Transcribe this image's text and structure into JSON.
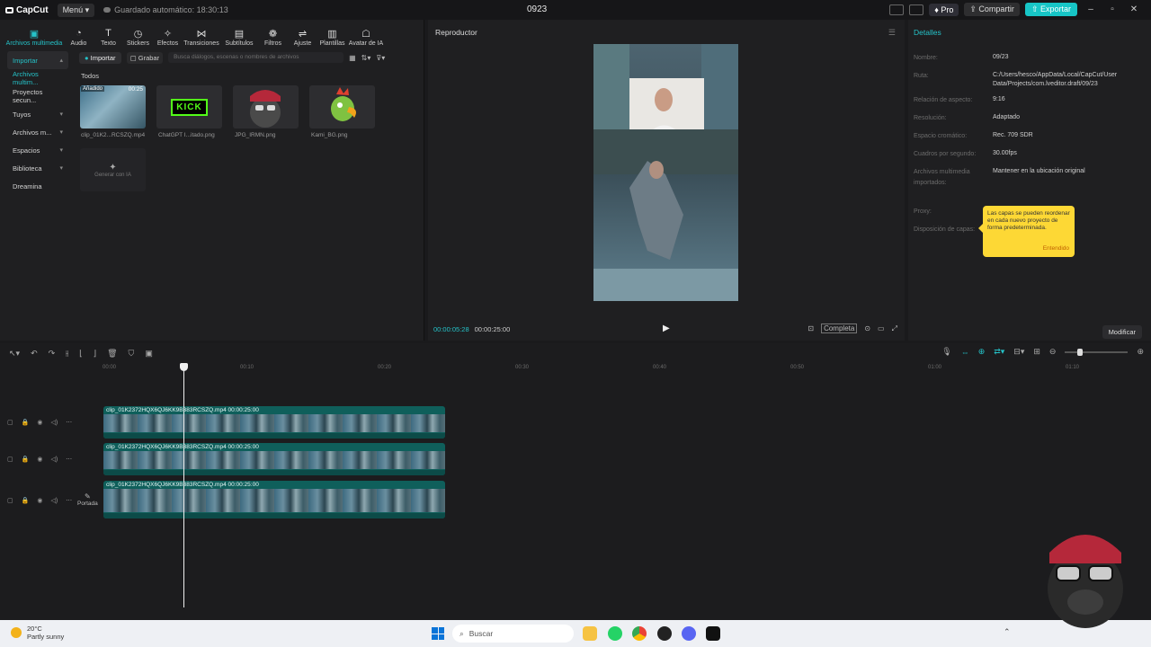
{
  "titlebar": {
    "logo": "CapCut",
    "menu": "Menú",
    "saved": "Guardado automático: 18:30:13",
    "project": "0923",
    "pro": "Pro",
    "share": "Compartir",
    "export": "Exportar"
  },
  "toolbar": [
    {
      "label": "Archivos multimedia",
      "icon": "media-icon"
    },
    {
      "label": "Audio",
      "icon": "audio-icon"
    },
    {
      "label": "Texto",
      "icon": "text-icon"
    },
    {
      "label": "Stickers",
      "icon": "sticker-icon"
    },
    {
      "label": "Efectos",
      "icon": "effects-icon"
    },
    {
      "label": "Transiciones",
      "icon": "transition-icon"
    },
    {
      "label": "Subtítulos",
      "icon": "subtitle-icon"
    },
    {
      "label": "Filtros",
      "icon": "filter-icon"
    },
    {
      "label": "Ajuste",
      "icon": "adjust-icon"
    },
    {
      "label": "Plantillas",
      "icon": "template-icon"
    },
    {
      "label": "Avatar de IA",
      "icon": "avatar-icon"
    }
  ],
  "sidebar": [
    {
      "label": "Importar"
    },
    {
      "label": "Archivos multim..."
    },
    {
      "label": "Proyectos secun..."
    },
    {
      "label": "Tuyos"
    },
    {
      "label": "Archivos m..."
    },
    {
      "label": "Espacios"
    },
    {
      "label": "Biblioteca"
    },
    {
      "label": "Dreamina"
    }
  ],
  "media": {
    "import_btn": "Importar",
    "record_btn": "Grabar",
    "search_placeholder": "Busca diálogos, escenas o nombres de archivos",
    "filter_all": "Todos",
    "items": [
      {
        "name": "clip_01K2...RCSZQ.mp4",
        "badge": "Añadido",
        "duration": "00:25"
      },
      {
        "name": "ChatGPT I...itado.png",
        "logo_text": "KICK"
      },
      {
        "name": "JPG_IRMN.png"
      },
      {
        "name": "Kami_BG.png"
      }
    ],
    "generate": "Generar con IA"
  },
  "player": {
    "title": "Reproductor",
    "current": "00:00:05:28",
    "total": "00:00:25:00",
    "ratio_btn": "Completa"
  },
  "details": {
    "title": "Detalles",
    "rows": [
      {
        "key": "Nombre:",
        "value": "09/23"
      },
      {
        "key": "Ruta:",
        "value": "C:/Users/hesco/AppData/Local/CapCut/User Data/Projects/com.lveditor.draft/09/23"
      },
      {
        "key": "Relación de aspecto:",
        "value": "9:16"
      },
      {
        "key": "Resolución:",
        "value": "Adaptado"
      },
      {
        "key": "Espacio cromático:",
        "value": "Rec. 709 SDR"
      },
      {
        "key": "Cuadros por segundo:",
        "value": "30.00fps"
      },
      {
        "key": "Archivos multimedia importados:",
        "value": "Mantener en la ubicación original"
      },
      {
        "key": "Proxy:",
        "value": ""
      },
      {
        "key": "Disposición de capas:",
        "value": ""
      }
    ],
    "tooltip": "Las capas se pueden reordenar en cada nuevo proyecto de forma predeterminada.",
    "tooltip_ok": "Entendido",
    "modify": "Modificar"
  },
  "timeline": {
    "ticks": [
      "00:00",
      "00:10",
      "00:20",
      "00:30",
      "00:40",
      "00:50",
      "01:00",
      "01:10"
    ],
    "clips": [
      {
        "label": "clip_01K2372HQX6QJ6KK9B383RCSZQ.mp4   00:00:25:00"
      },
      {
        "label": "clip_01K2372HQX6QJ6KK9B383RCSZQ.mp4   00:00:25:00"
      },
      {
        "label": "clip_01K2372HQX6QJ6KK9B383RCSZQ.mp4   00:00:25:00"
      }
    ],
    "cover": "Portada"
  },
  "taskbar": {
    "temp": "20°C",
    "weather": "Partly sunny",
    "search": "Buscar"
  },
  "colors": {
    "accent": "#25c2c8",
    "tooltip": "#fdd835",
    "clip": "#0f5f5b"
  }
}
